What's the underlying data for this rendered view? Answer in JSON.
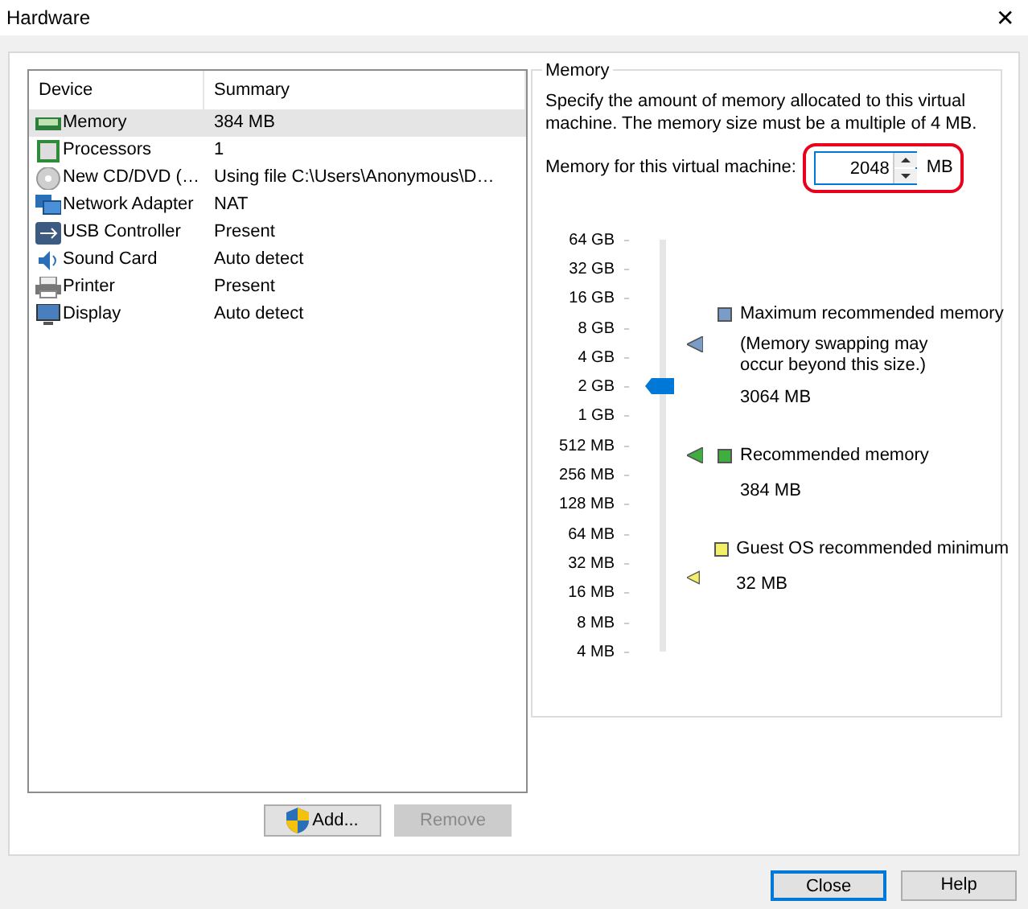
{
  "window": {
    "title": "Hardware",
    "close": "✕"
  },
  "device_table": {
    "columns": [
      "Device",
      "Summary"
    ],
    "rows": [
      {
        "kind": "memory",
        "device": "Memory",
        "summary": "384 MB",
        "selected": true
      },
      {
        "kind": "cpu",
        "device": "Processors",
        "summary": "1",
        "selected": false
      },
      {
        "kind": "cd",
        "device": "New CD/DVD (…",
        "summary": "Using file C:\\Users\\Anonymous\\D…",
        "selected": false
      },
      {
        "kind": "network",
        "device": "Network Adapter",
        "summary": "NAT",
        "selected": false
      },
      {
        "kind": "usb",
        "device": "USB Controller",
        "summary": "Present",
        "selected": false
      },
      {
        "kind": "sound",
        "device": "Sound Card",
        "summary": "Auto detect",
        "selected": false
      },
      {
        "kind": "printer",
        "device": "Printer",
        "summary": "Present",
        "selected": false
      },
      {
        "kind": "display",
        "device": "Display",
        "summary": "Auto detect",
        "selected": false
      }
    ]
  },
  "list_buttons": [
    {
      "label": "Add...",
      "disabled": false,
      "shield": true
    },
    {
      "label": "Remove",
      "disabled": true,
      "shield": false
    }
  ],
  "memory": {
    "title": "Memory",
    "description": "Specify the amount of memory allocated to this virtual machine. The memory size must be a multiple of 4 MB.",
    "field_label": "Memory for this virtual machine:",
    "value": "2048",
    "unit": "MB",
    "slider": {
      "ticks": [
        "64 GB",
        "32 GB",
        "16 GB",
        "8 GB",
        "4 GB",
        "2 GB",
        "1 GB",
        "512 MB",
        "256 MB",
        "128 MB",
        "64 MB",
        "32 MB",
        "16 MB",
        "8 MB",
        "4 MB"
      ],
      "level": 0.643
    },
    "markers": [
      {
        "label": "Maximum recommended memory",
        "note": "(Memory swapping may occur beyond this size.)",
        "value": "3064 MB",
        "color": "#7a9cc8"
      },
      {
        "label": "Recommended memory",
        "value": "384 MB",
        "color": "#3fae3f"
      },
      {
        "label": "Guest OS recommended minimum",
        "value": "32 MB",
        "color": "#f2ef6b"
      }
    ]
  },
  "footer_buttons": [
    {
      "label": "Close",
      "selected": true
    },
    {
      "label": "Help",
      "selected": false
    }
  ]
}
